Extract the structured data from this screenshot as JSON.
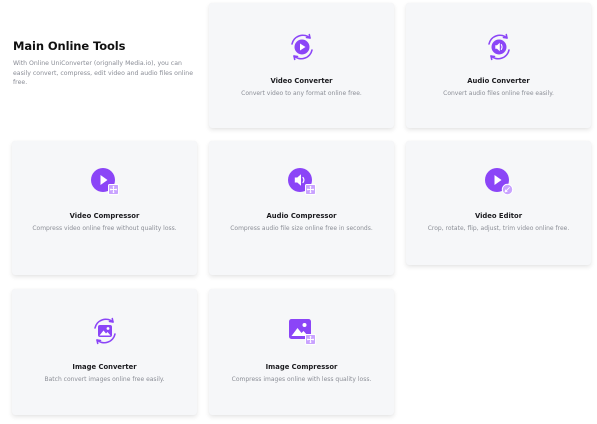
{
  "section": {
    "title": "Main Online Tools",
    "description": "With Online UniConverter (orignally Media.io), you can easily convert, compress, edit video and audio files online free."
  },
  "tools": [
    {
      "title": "Video Converter",
      "description": "Convert video to any format online free.",
      "icon": "video-convert-icon"
    },
    {
      "title": "Audio Converter",
      "description": "Convert audio files online free easily.",
      "icon": "audio-convert-icon"
    },
    {
      "title": "Video Compressor",
      "description": "Compress video online free without quality loss.",
      "icon": "video-compress-icon"
    },
    {
      "title": "Audio Compressor",
      "description": "Compress audio file size online free in seconds.",
      "icon": "audio-compress-icon"
    },
    {
      "title": "Video Editor",
      "description": "Crop, rotate, flip, adjust, trim video online free.",
      "icon": "video-edit-icon"
    },
    {
      "title": "Image Converter",
      "description": "Batch convert images online free easily.",
      "icon": "image-convert-icon"
    },
    {
      "title": "Image Compressor",
      "description": "Compress images online with less quality loss.",
      "icon": "image-compress-icon"
    }
  ],
  "colors": {
    "accent": "#8b45f7",
    "accent_light": "#c9a3ff",
    "card_bg": "#f6f7f9"
  }
}
